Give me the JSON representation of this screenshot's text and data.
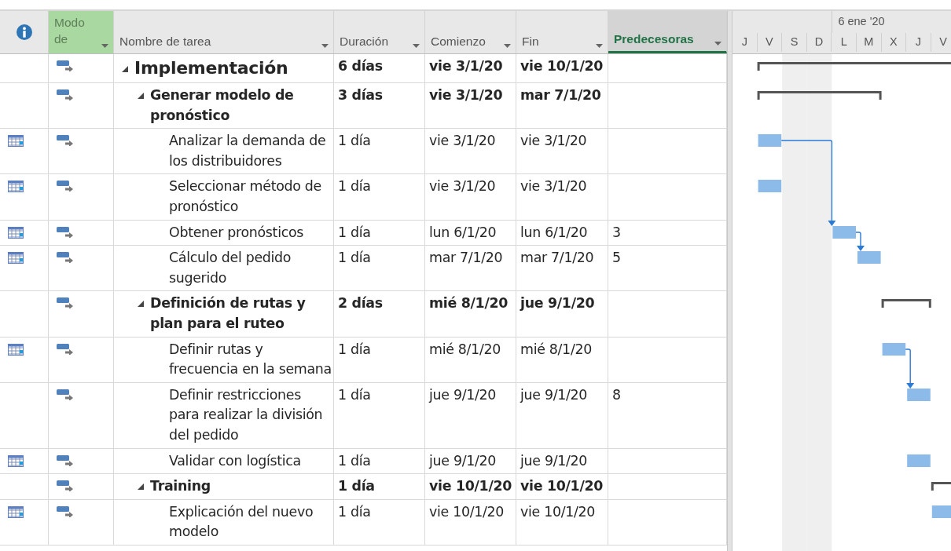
{
  "table": {
    "columns": [
      {
        "kind": "info",
        "selected": false,
        "highlighted": false
      },
      {
        "kind": "text",
        "label": "Modo de",
        "selected": false,
        "highlighted": true
      },
      {
        "kind": "text",
        "label": "Nombre de tarea",
        "selected": false,
        "highlighted": false
      },
      {
        "kind": "text",
        "label": "Duración",
        "selected": false,
        "highlighted": false
      },
      {
        "kind": "text",
        "label": "Comienzo",
        "selected": false,
        "highlighted": false
      },
      {
        "kind": "text",
        "label": "Fin",
        "selected": false,
        "highlighted": false
      },
      {
        "kind": "text",
        "label": "Predecesoras",
        "selected": true,
        "highlighted": false
      }
    ],
    "tasks": [
      {
        "kind": "summary",
        "name": "Implementación",
        "duration": "6 días",
        "start": "vie 3/1/20",
        "finish": "vie 10/1/20",
        "calendar_icon": false,
        "expanded": true,
        "children": [
          {
            "kind": "summary",
            "name": "Generar modelo de pronóstico",
            "duration": "3 días",
            "start": "vie 3/1/20",
            "finish": "mar 7/1/20",
            "calendar_icon": false,
            "expanded": true,
            "children": [
              {
                "kind": "task",
                "name": "Analizar la demanda de los distribuidores",
                "duration": "1 día",
                "start": "vie 3/1/20",
                "finish": "vie 3/1/20",
                "calendar_icon": true
              },
              {
                "kind": "task",
                "name": "Seleccionar método de pronóstico",
                "duration": "1 día",
                "start": "vie 3/1/20",
                "finish": "vie 3/1/20",
                "calendar_icon": true
              },
              {
                "kind": "task",
                "name": "Obtener pronósticos",
                "duration": "1 día",
                "start": "lun 6/1/20",
                "finish": "lun 6/1/20",
                "predecessors": "3",
                "calendar_icon": true
              },
              {
                "kind": "task",
                "name": "Cálculo del pedido sugerido",
                "duration": "1 día",
                "start": "mar 7/1/20",
                "finish": "mar 7/1/20",
                "predecessors": "5",
                "calendar_icon": true
              }
            ]
          },
          {
            "kind": "summary",
            "name": "Definición de rutas y plan para el ruteo",
            "duration": "2 días",
            "start": "mié 8/1/20",
            "finish": "jue 9/1/20",
            "calendar_icon": false,
            "expanded": true,
            "children": [
              {
                "kind": "task",
                "name": "Definir rutas y frecuencia en la semana",
                "duration": "1 día",
                "start": "mié 8/1/20",
                "finish": "mié 8/1/20",
                "calendar_icon": true
              },
              {
                "kind": "task",
                "name": "Definir restricciones para realizar la división del pedido",
                "duration": "1 día",
                "start": "jue 9/1/20",
                "finish": "jue 9/1/20",
                "predecessors": "8",
                "calendar_icon": false
              },
              {
                "kind": "task",
                "name": "Validar con logística",
                "duration": "1 día",
                "start": "jue 9/1/20",
                "finish": "jue 9/1/20",
                "calendar_icon": true
              }
            ]
          },
          {
            "kind": "summary",
            "name": "Training",
            "duration": "1 día",
            "start": "vie 10/1/20",
            "finish": "vie 10/1/20",
            "calendar_icon": false,
            "expanded": true,
            "children": [
              {
                "kind": "task",
                "name": "Explicación del nuevo modelo",
                "duration": "1 día",
                "start": "vie 10/1/20",
                "finish": "vie 10/1/20",
                "calendar_icon": true
              }
            ]
          }
        ]
      }
    ]
  },
  "timescale": {
    "days": [
      {
        "letter": "J",
        "nonworking": false
      },
      {
        "letter": "V",
        "nonworking": false
      },
      {
        "letter": "S",
        "nonworking": true
      },
      {
        "letter": "D",
        "nonworking": true
      },
      {
        "letter": "L",
        "nonworking": false,
        "week_label": "6 ene '20"
      },
      {
        "letter": "M",
        "nonworking": false
      },
      {
        "letter": "X",
        "nonworking": false
      },
      {
        "letter": "J",
        "nonworking": false
      },
      {
        "letter": "V",
        "nonworking": false
      }
    ]
  }
}
